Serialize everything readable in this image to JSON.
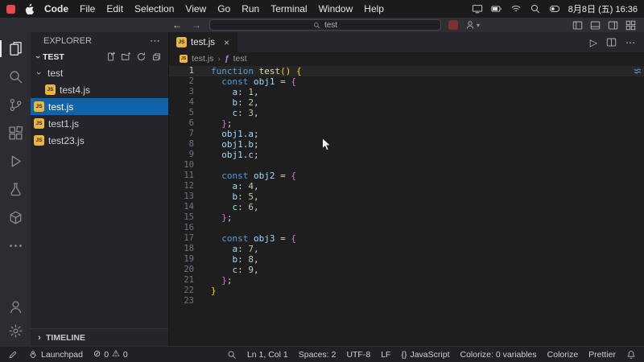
{
  "menubar": {
    "app_name": "Code",
    "items": [
      "File",
      "Edit",
      "Selection",
      "View",
      "Go",
      "Run",
      "Terminal",
      "Window",
      "Help"
    ],
    "clock": "8月8日 (五) 16:36"
  },
  "titlebar": {
    "search_value": "test"
  },
  "activitybar": {
    "items": [
      {
        "name": "explorer",
        "icon": "explorer",
        "active": true
      },
      {
        "name": "search",
        "icon": "search"
      },
      {
        "name": "source-control",
        "icon": "source-control"
      },
      {
        "name": "extensions",
        "icon": "extensions"
      },
      {
        "name": "run-and-debug",
        "icon": "run-debug"
      },
      {
        "name": "testing",
        "icon": "testing"
      },
      {
        "name": "extension-cube",
        "icon": "cube"
      },
      {
        "name": "more-views",
        "icon": "more"
      }
    ],
    "bottom": [
      {
        "name": "accounts",
        "icon": "accounts"
      },
      {
        "name": "manage-settings",
        "icon": "settings"
      }
    ]
  },
  "explorer": {
    "title": "EXPLORER",
    "section_title": "TEST",
    "timeline_label": "TIMELINE",
    "tree": [
      {
        "label": "test",
        "kind": "folder",
        "indent": 0,
        "expanded": true
      },
      {
        "label": "test4.js",
        "kind": "js",
        "indent": 1
      },
      {
        "label": "test.js",
        "kind": "js",
        "indent": 0,
        "selected": true
      },
      {
        "label": "test1.js",
        "kind": "js",
        "indent": 0
      },
      {
        "label": "test23.js",
        "kind": "js",
        "indent": 0
      }
    ]
  },
  "editor": {
    "tab_label": "test.js",
    "breadcrumb": {
      "file": "test.js",
      "symbol": "test"
    },
    "token_colors": {
      "kw": "#569cd6",
      "fn": "#dcdcaa",
      "vr": "#9cdcfe",
      "nm": "#b5cea8",
      "pl": "#d4d4d4",
      "b1": "#ffd700",
      "b2": "#da70d6"
    },
    "code": [
      {
        "ln": 1,
        "toks": [
          [
            "kw",
            "function "
          ],
          [
            "fn",
            "test"
          ],
          [
            "b1",
            "()"
          ],
          [
            "pl",
            " "
          ],
          [
            "b1",
            "{"
          ]
        ]
      },
      {
        "ln": 2,
        "toks": [
          [
            "pl",
            "  "
          ],
          [
            "kw",
            "const "
          ],
          [
            "vr",
            "obj1"
          ],
          [
            "pl",
            " = "
          ],
          [
            "b2",
            "{"
          ]
        ]
      },
      {
        "ln": 3,
        "toks": [
          [
            "pl",
            "    "
          ],
          [
            "vr",
            "a"
          ],
          [
            "pl",
            ": "
          ],
          [
            "nm",
            "1"
          ],
          [
            "pl",
            ","
          ]
        ]
      },
      {
        "ln": 4,
        "toks": [
          [
            "pl",
            "    "
          ],
          [
            "vr",
            "b"
          ],
          [
            "pl",
            ": "
          ],
          [
            "nm",
            "2"
          ],
          [
            "pl",
            ","
          ]
        ]
      },
      {
        "ln": 5,
        "toks": [
          [
            "pl",
            "    "
          ],
          [
            "vr",
            "c"
          ],
          [
            "pl",
            ": "
          ],
          [
            "nm",
            "3"
          ],
          [
            "pl",
            ","
          ]
        ]
      },
      {
        "ln": 6,
        "toks": [
          [
            "pl",
            "  "
          ],
          [
            "b2",
            "}"
          ],
          [
            "pl",
            ";"
          ]
        ]
      },
      {
        "ln": 7,
        "toks": [
          [
            "pl",
            "  "
          ],
          [
            "vr",
            "obj1"
          ],
          [
            "pl",
            "."
          ],
          [
            "vr",
            "a"
          ],
          [
            "pl",
            ";"
          ]
        ]
      },
      {
        "ln": 8,
        "toks": [
          [
            "pl",
            "  "
          ],
          [
            "vr",
            "obj1"
          ],
          [
            "pl",
            "."
          ],
          [
            "vr",
            "b"
          ],
          [
            "pl",
            ";"
          ]
        ]
      },
      {
        "ln": 9,
        "toks": [
          [
            "pl",
            "  "
          ],
          [
            "vr",
            "obj1"
          ],
          [
            "pl",
            "."
          ],
          [
            "vr",
            "c"
          ],
          [
            "pl",
            ";"
          ]
        ]
      },
      {
        "ln": 10,
        "toks": []
      },
      {
        "ln": 11,
        "toks": [
          [
            "pl",
            "  "
          ],
          [
            "kw",
            "const "
          ],
          [
            "vr",
            "obj2"
          ],
          [
            "pl",
            " = "
          ],
          [
            "b2",
            "{"
          ]
        ]
      },
      {
        "ln": 12,
        "toks": [
          [
            "pl",
            "    "
          ],
          [
            "vr",
            "a"
          ],
          [
            "pl",
            ": "
          ],
          [
            "nm",
            "4"
          ],
          [
            "pl",
            ","
          ]
        ]
      },
      {
        "ln": 13,
        "toks": [
          [
            "pl",
            "    "
          ],
          [
            "vr",
            "b"
          ],
          [
            "pl",
            ": "
          ],
          [
            "nm",
            "5"
          ],
          [
            "pl",
            ","
          ]
        ]
      },
      {
        "ln": 14,
        "toks": [
          [
            "pl",
            "    "
          ],
          [
            "vr",
            "c"
          ],
          [
            "pl",
            ": "
          ],
          [
            "nm",
            "6"
          ],
          [
            "pl",
            ","
          ]
        ]
      },
      {
        "ln": 15,
        "toks": [
          [
            "pl",
            "  "
          ],
          [
            "b2",
            "}"
          ],
          [
            "pl",
            ";"
          ]
        ]
      },
      {
        "ln": 16,
        "toks": []
      },
      {
        "ln": 17,
        "toks": [
          [
            "pl",
            "  "
          ],
          [
            "kw",
            "const "
          ],
          [
            "vr",
            "obj3"
          ],
          [
            "pl",
            " = "
          ],
          [
            "b2",
            "{"
          ]
        ]
      },
      {
        "ln": 18,
        "toks": [
          [
            "pl",
            "    "
          ],
          [
            "vr",
            "a"
          ],
          [
            "pl",
            ": "
          ],
          [
            "nm",
            "7"
          ],
          [
            "pl",
            ","
          ]
        ]
      },
      {
        "ln": 19,
        "toks": [
          [
            "pl",
            "    "
          ],
          [
            "vr",
            "b"
          ],
          [
            "pl",
            ": "
          ],
          [
            "nm",
            "8"
          ],
          [
            "pl",
            ","
          ]
        ]
      },
      {
        "ln": 20,
        "toks": [
          [
            "pl",
            "    "
          ],
          [
            "vr",
            "c"
          ],
          [
            "pl",
            ": "
          ],
          [
            "nm",
            "9"
          ],
          [
            "pl",
            ","
          ]
        ]
      },
      {
        "ln": 21,
        "toks": [
          [
            "pl",
            "  "
          ],
          [
            "b2",
            "}"
          ],
          [
            "pl",
            ";"
          ]
        ]
      },
      {
        "ln": 22,
        "toks": [
          [
            "b1",
            "}"
          ]
        ]
      },
      {
        "ln": 23,
        "toks": []
      }
    ]
  },
  "statusbar": {
    "launchpad": "Launchpad",
    "errors": "0",
    "warnings": "0",
    "cursor": "Ln 1, Col 1",
    "indent": "Spaces: 2",
    "encoding": "UTF-8",
    "eol": "LF",
    "language": "JavaScript",
    "colorize_count": "Colorize: 0 variables",
    "colorize": "Colorize",
    "prettier": "Prettier"
  },
  "icons": {
    "js_badge": "JS"
  },
  "colors": {
    "selection_blue": "#0f63ab",
    "js_icon_yellow": "#eab543",
    "record_red": "#e5484d"
  }
}
